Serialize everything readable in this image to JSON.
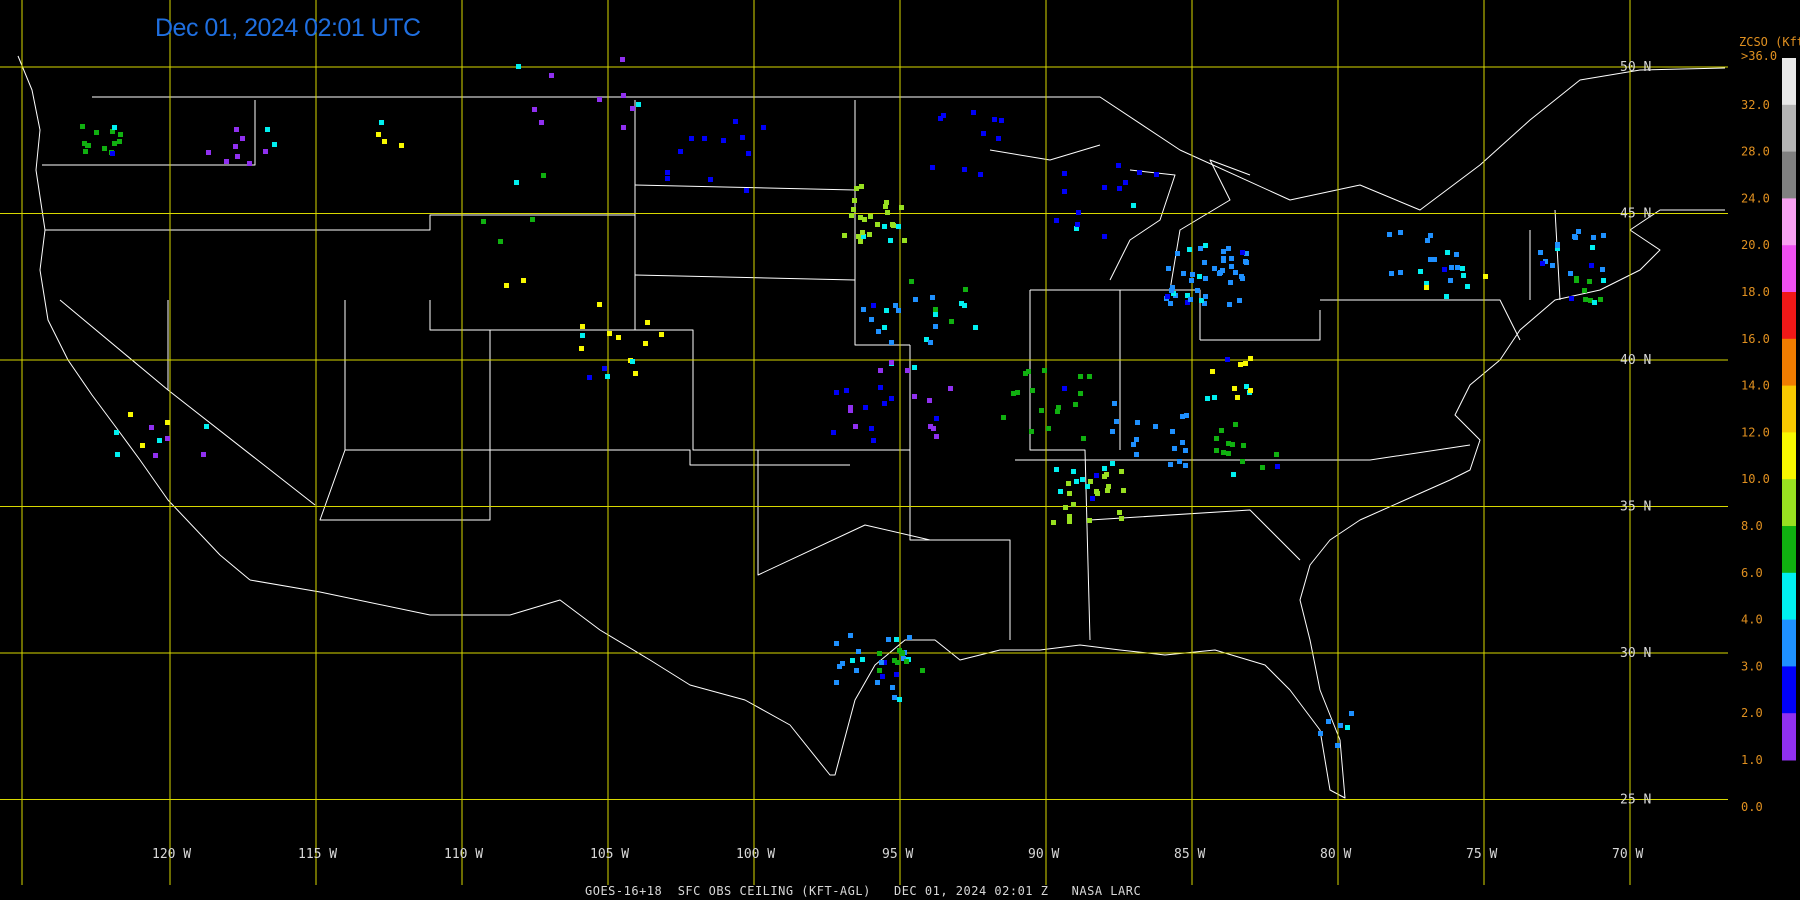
{
  "timestamp": "Dec 01, 2024 02:01 UTC",
  "footer": "GOES-16+18  SFC OBS CEILING (KFT-AGL)   DEC 01, 2024 02:01 Z   NASA LARC",
  "lat_labels": [
    "50 N",
    "45 N",
    "40 N",
    "35 N",
    "30 N",
    "25 N"
  ],
  "lon_labels": [
    "120 W",
    "115 W",
    "110 W",
    "105 W",
    "100 W",
    "95 W",
    "90 W",
    "85 W",
    "80 W",
    "75 W",
    "70 W"
  ],
  "legend": {
    "title": "ZCSO (Kft)",
    "top": ">36.0",
    "labels": [
      "32.0",
      "28.0",
      "24.0",
      "20.0",
      "18.0",
      "16.0",
      "14.0",
      "12.0",
      "10.0",
      "8.0",
      "6.0",
      "4.0",
      "3.0",
      "2.0",
      "1.0",
      "0.0"
    ],
    "colors": [
      "#e8e8e8",
      "#b4b4b4",
      "#808080",
      "#f8a0f0",
      "#f050f0",
      "#f01818",
      "#f07c00",
      "#f8c800",
      "#f8f800",
      "#98e020",
      "#10b010",
      "#00f0f0",
      "#1e90ff",
      "#0000f8",
      "#9030f0"
    ]
  },
  "colors": {
    "grid": "#d8d800",
    "border": "#ffffff",
    "label": "#d8d8d8",
    "legend_text": "#e09020",
    "timestamp": "#1f6fe0"
  },
  "station_clusters": [
    {
      "lon": -122.5,
      "lat": 47.5,
      "n": 14,
      "c": "green",
      "s": 0.8
    },
    {
      "lon": -117.5,
      "lat": 47.5,
      "n": 10,
      "c": "purple",
      "s": 1.2
    },
    {
      "lon": -113,
      "lat": 47.8,
      "n": 4,
      "c": "yellow",
      "s": 1.0
    },
    {
      "lon": -106,
      "lat": 48.3,
      "n": 10,
      "c": "purple",
      "s": 2.5
    },
    {
      "lon": -101,
      "lat": 47,
      "n": 12,
      "c": "blue",
      "s": 2.0
    },
    {
      "lon": -96,
      "lat": 45,
      "n": 25,
      "c": "lime",
      "s": 1.2
    },
    {
      "lon": -93,
      "lat": 47.5,
      "n": 10,
      "c": "blue",
      "s": 1.5
    },
    {
      "lon": -88,
      "lat": 45.5,
      "n": 14,
      "c": "blue",
      "s": 1.8
    },
    {
      "lon": -84.5,
      "lat": 43,
      "n": 45,
      "c": "dodger",
      "s": 1.4
    },
    {
      "lon": -95,
      "lat": 41.2,
      "n": 14,
      "c": "dodger",
      "s": 1.3
    },
    {
      "lon": -93.5,
      "lat": 41.8,
      "n": 8,
      "c": "green",
      "s": 1.2
    },
    {
      "lon": -95,
      "lat": 38.8,
      "n": 16,
      "c": "purple",
      "s": 1.8
    },
    {
      "lon": -96.5,
      "lat": 38.2,
      "n": 8,
      "c": "blue",
      "s": 1.2
    },
    {
      "lon": -90,
      "lat": 38.5,
      "n": 18,
      "c": "green",
      "s": 1.5
    },
    {
      "lon": -86.5,
      "lat": 37.5,
      "n": 18,
      "c": "dodger",
      "s": 1.5
    },
    {
      "lon": -88.5,
      "lat": 35.5,
      "n": 28,
      "c": "lime",
      "s": 1.3
    },
    {
      "lon": -83.5,
      "lat": 39.5,
      "n": 12,
      "c": "yellow",
      "s": 1.0
    },
    {
      "lon": -83,
      "lat": 37,
      "n": 14,
      "c": "green",
      "s": 1.3
    },
    {
      "lon": -104.5,
      "lat": 40.2,
      "n": 12,
      "c": "yellow",
      "s": 1.5
    },
    {
      "lon": -96,
      "lat": 29.5,
      "n": 22,
      "c": "dodger",
      "s": 1.4
    },
    {
      "lon": -95,
      "lat": 29.8,
      "n": 10,
      "c": "green",
      "s": 0.8
    },
    {
      "lon": -80.2,
      "lat": 27.5,
      "n": 6,
      "c": "dodger",
      "s": 0.8
    },
    {
      "lon": -77,
      "lat": 43.3,
      "n": 16,
      "c": "dodger",
      "s": 1.5
    },
    {
      "lon": -76,
      "lat": 43,
      "n": 6,
      "c": "yellow",
      "s": 1.2
    },
    {
      "lon": -72,
      "lat": 43.5,
      "n": 16,
      "c": "dodger",
      "s": 1.2
    },
    {
      "lon": -71.5,
      "lat": 42.2,
      "n": 10,
      "c": "green",
      "s": 0.8
    },
    {
      "lon": -121,
      "lat": 37.5,
      "n": 6,
      "c": "yellow",
      "s": 1.0
    },
    {
      "lon": -119.5,
      "lat": 37.5,
      "n": 5,
      "c": "purple",
      "s": 1.2
    },
    {
      "lon": -108,
      "lat": 45.5,
      "n": 5,
      "c": "green",
      "s": 2.0
    },
    {
      "lon": -106.5,
      "lat": 42.5,
      "n": 5,
      "c": "yellow",
      "s": 2.0
    }
  ]
}
